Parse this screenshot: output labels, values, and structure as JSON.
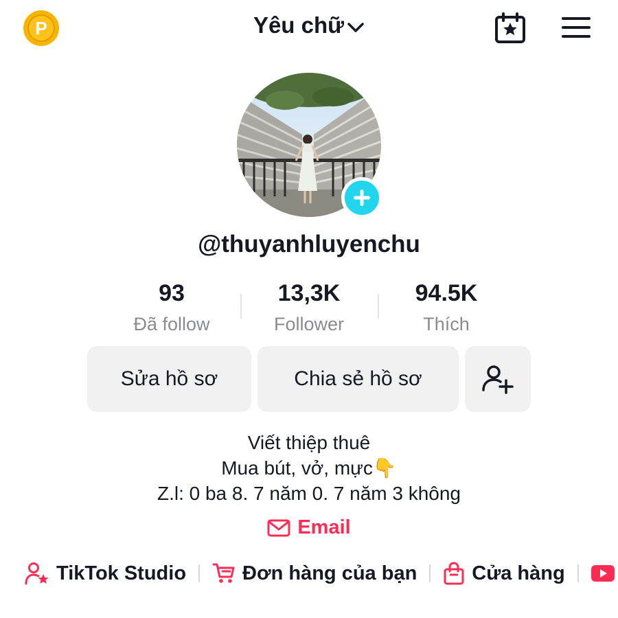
{
  "header": {
    "coin_icon": "coin-icon",
    "coin_letter": "P",
    "account_name": "Yêu chữ",
    "calendar_icon": "calendar-star-icon",
    "menu_icon": "hamburger-menu-icon"
  },
  "profile": {
    "avatar_icon": "avatar-photo",
    "add_icon": "plus-icon",
    "username": "@thuyanhluyenchu"
  },
  "stats": [
    {
      "value": "93",
      "label": "Đã follow"
    },
    {
      "value": "13,3K",
      "label": "Follower"
    },
    {
      "value": "94.5K",
      "label": "Thích"
    }
  ],
  "actions": {
    "edit_profile": "Sửa hồ sơ",
    "share_profile": "Chia sẻ hồ sơ",
    "add_friend_icon": "add-user-icon"
  },
  "bio": {
    "line1": "Viết thiệp thuê",
    "line2": "Mua bút, vở, mực👇",
    "line3": "Z.l: 0 ba 8. 7 năm 0. 7 năm 3 không"
  },
  "email": {
    "label": "Email",
    "icon": "envelope-icon"
  },
  "links": [
    {
      "label": "TikTok Studio",
      "icon": "person-star-icon"
    },
    {
      "label": "Đơn hàng của bạn",
      "icon": "cart-icon"
    },
    {
      "label": "Cửa hàng",
      "icon": "shopping-bag-icon"
    },
    {
      "label": "",
      "icon": "youtube-icon"
    }
  ],
  "colors": {
    "accent": "#fe2c55",
    "plus_badge": "#20d5ec",
    "coin": "#ffc21a",
    "button_bg": "#f1f1f2",
    "muted_text": "#8a8b91"
  }
}
